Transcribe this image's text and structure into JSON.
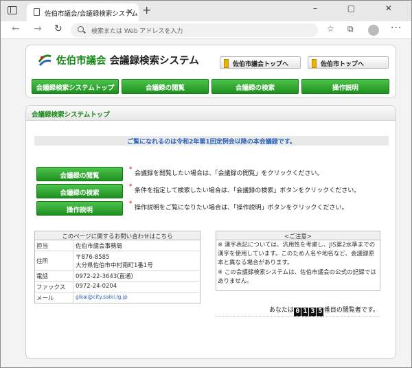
{
  "browser": {
    "tab_title": "佐伯市議会/会議録検索システム",
    "tab_close": "✕",
    "new_tab": "+",
    "address_placeholder": "検索または Web アドレスを入力",
    "window_controls": "– ▢ ✕",
    "more_menu": "···"
  },
  "header": {
    "title_green": "佐伯市議会",
    "title_dark": "会議録検索システム",
    "link_council_top": "佐伯市議会トップへ",
    "link_city_top": "佐伯市トップへ",
    "nav": [
      "会議録検索システムトップ",
      "会議録の閲覧",
      "会議録の検索",
      "操作説明"
    ]
  },
  "main": {
    "heading": "会議録検索システムトップ",
    "notice": "ご覧になれるのは令和2年第1回定例会以降の本会議録です。",
    "actions": [
      {
        "label": "会議録の閲覧",
        "desc": "会議録を閲覧したい場合は、「会議録の閲覧」をクリックください。"
      },
      {
        "label": "会議録の検索",
        "desc": "条件を指定して検索したい場合は、「会議録の検索」ボタンをクリックください。"
      },
      {
        "label": "操作説明",
        "desc": "操作説明をご覧になりたい場合は、「操作説明」ボタンをクリックください。"
      }
    ],
    "star": "*"
  },
  "contact": {
    "heading": "このページに関するお問い合わせはこちら",
    "rows": [
      {
        "key": "担当",
        "value": "佐伯市議会事務局"
      },
      {
        "key": "住所",
        "value": "〒876-8585",
        "value2": "大分県佐伯市中村南町1番1号"
      },
      {
        "key": "電話",
        "value": "0972-22-3643(直通)"
      },
      {
        "key": "ファックス",
        "value": "0972-24-0204"
      },
      {
        "key": "メール",
        "value": "gikai@city.saiki.lg.jp"
      }
    ]
  },
  "caution": {
    "heading": "<ご注意>",
    "p1": "※ 漢字表記については、汎用性を考慮し、JIS第2水準までの漢字を使用しています。このため人名や地名など、会議録原本と異なる場合があります。",
    "p2": "※ この会議録検索システムは、佐伯市議会の公式の記録ではありません。"
  },
  "counter": {
    "prefix": "あなたは",
    "digits": [
      "0",
      "1",
      "3",
      "5"
    ],
    "suffix": "番目の閲覧者です。"
  },
  "colors": {
    "accent_green": "#1a8a1a",
    "notice_blue": "#2a63b8"
  }
}
